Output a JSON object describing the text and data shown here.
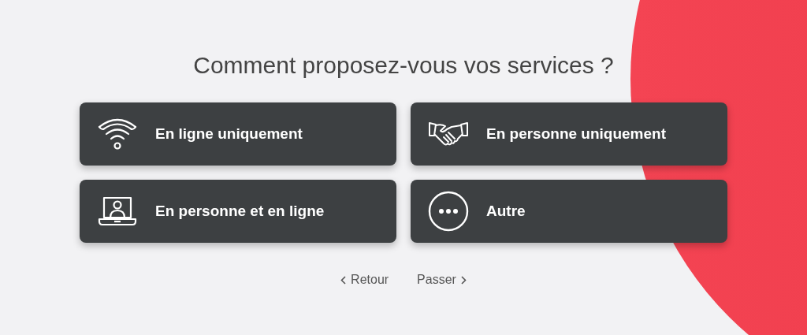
{
  "title": "Comment proposez-vous vos services ?",
  "options": [
    {
      "label": "En ligne uniquement",
      "kind": "wifi"
    },
    {
      "label": "En personne uniquement",
      "kind": "handshake"
    },
    {
      "label": "En personne et en ligne",
      "kind": "laptop"
    },
    {
      "label": "Autre",
      "kind": "more"
    }
  ],
  "nav": {
    "back": "Retour",
    "skip": "Passer"
  }
}
